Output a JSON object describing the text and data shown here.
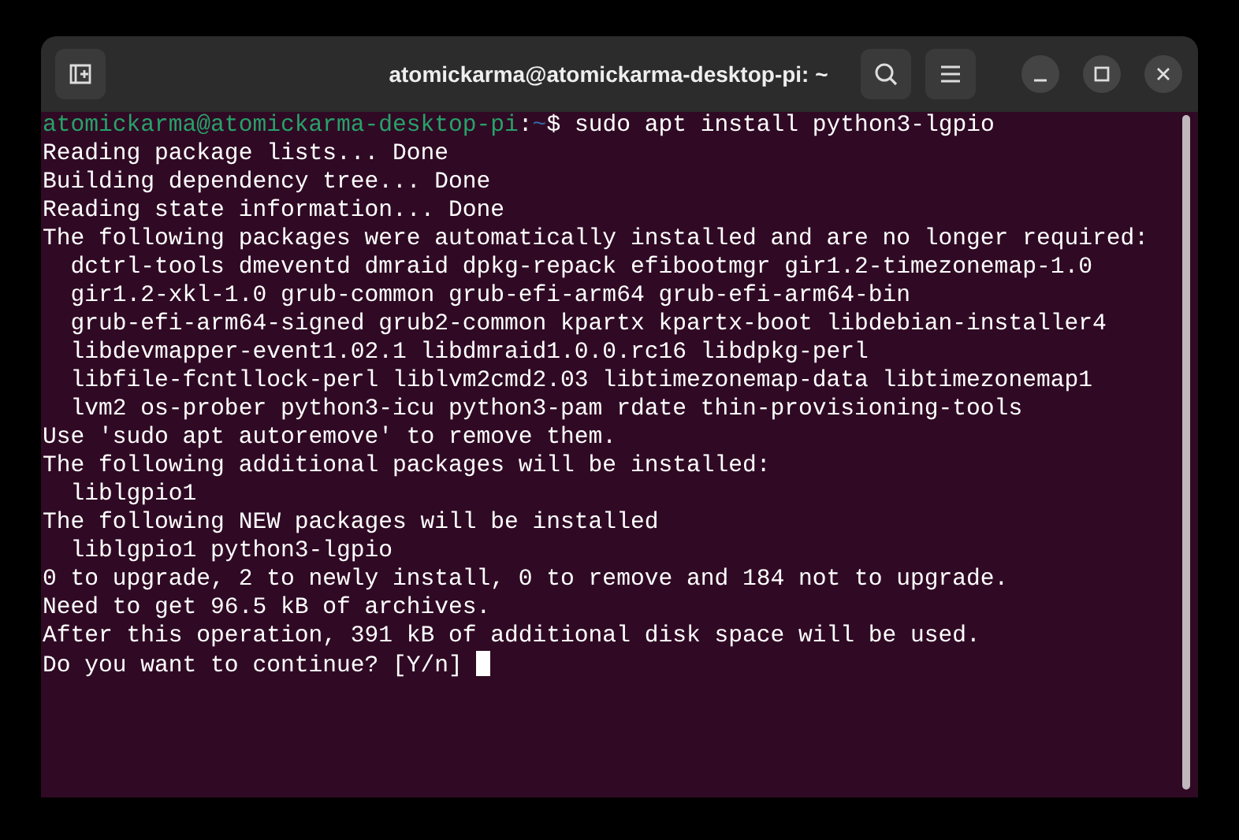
{
  "window": {
    "title": "atomickarma@atomickarma-desktop-pi: ~"
  },
  "terminal": {
    "lines": [
      {
        "kind": "prompt",
        "user_host": "atomickarma@atomickarma-desktop-pi",
        "separator": ":",
        "path": "~",
        "symbol": "$",
        "command": "sudo apt install python3-lgpio"
      },
      {
        "kind": "output",
        "text": "Reading package lists... Done"
      },
      {
        "kind": "output",
        "text": "Building dependency tree... Done"
      },
      {
        "kind": "output",
        "text": "Reading state information... Done"
      },
      {
        "kind": "output",
        "text": "The following packages were automatically installed and are no longer required:"
      },
      {
        "kind": "output",
        "text": "  dctrl-tools dmeventd dmraid dpkg-repack efibootmgr gir1.2-timezonemap-1.0"
      },
      {
        "kind": "output",
        "text": "  gir1.2-xkl-1.0 grub-common grub-efi-arm64 grub-efi-arm64-bin"
      },
      {
        "kind": "output",
        "text": "  grub-efi-arm64-signed grub2-common kpartx kpartx-boot libdebian-installer4"
      },
      {
        "kind": "output",
        "text": "  libdevmapper-event1.02.1 libdmraid1.0.0.rc16 libdpkg-perl"
      },
      {
        "kind": "output",
        "text": "  libfile-fcntllock-perl liblvm2cmd2.03 libtimezonemap-data libtimezonemap1"
      },
      {
        "kind": "output",
        "text": "  lvm2 os-prober python3-icu python3-pam rdate thin-provisioning-tools"
      },
      {
        "kind": "output",
        "text": "Use 'sudo apt autoremove' to remove them."
      },
      {
        "kind": "output",
        "text": "The following additional packages will be installed:"
      },
      {
        "kind": "output",
        "text": "  liblgpio1"
      },
      {
        "kind": "output",
        "text": "The following NEW packages will be installed"
      },
      {
        "kind": "output",
        "text": "  liblgpio1 python3-lgpio"
      },
      {
        "kind": "output",
        "text": "0 to upgrade, 2 to newly install, 0 to remove and 184 not to upgrade."
      },
      {
        "kind": "output",
        "text": "Need to get 96.5 kB of archives."
      },
      {
        "kind": "output",
        "text": "After this operation, 391 kB of additional disk space will be used."
      },
      {
        "kind": "input",
        "text": "Do you want to continue? [Y/n] "
      }
    ]
  }
}
